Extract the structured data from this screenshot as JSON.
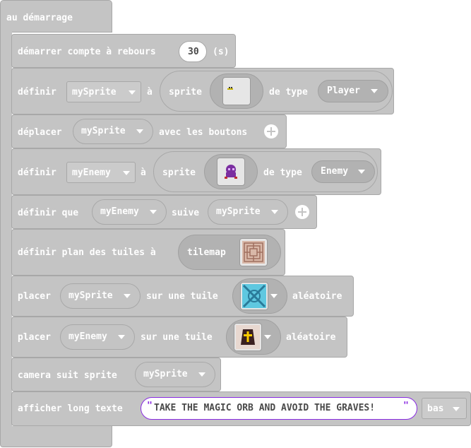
{
  "blocks": {
    "on_start": "au démarrage",
    "countdown": {
      "prefix": "démarrer compte à rebours",
      "value": "30",
      "suffix": "(s)"
    },
    "set_player": {
      "set": "définir",
      "var": "mySprite",
      "to": "à",
      "sprite": "sprite",
      "of_kind": "de type",
      "kind": "Player"
    },
    "move": {
      "prefix": "déplacer",
      "var": "mySprite",
      "suffix": "avec les boutons"
    },
    "set_enemy": {
      "set": "définir",
      "var": "myEnemy",
      "to": "à",
      "sprite": "sprite",
      "of_kind": "de type",
      "kind": "Enemy"
    },
    "follow": {
      "prefix": "définir que",
      "var": "myEnemy",
      "mid": "suive",
      "target": "mySprite"
    },
    "tilemap": {
      "prefix": "définir plan des tuiles à",
      "label": "tilemap"
    },
    "place_player": {
      "prefix": "placer",
      "var": "mySprite",
      "mid": "sur une tuile",
      "suffix": "aléatoire"
    },
    "place_enemy": {
      "prefix": "placer",
      "var": "myEnemy",
      "mid": "sur une tuile",
      "suffix": "aléatoire"
    },
    "camera": {
      "prefix": "camera suit sprite",
      "var": "mySprite"
    },
    "show_text": {
      "prefix": "afficher long texte",
      "text": "TAKE THE MAGIC ORB AND AVOID THE GRAVES!",
      "quote_open": "\"",
      "quote_close": "\"",
      "position": "bas"
    }
  },
  "colors": {
    "block": "#c4c4c4",
    "border": "#a8a8a8",
    "text": "#ffffff",
    "text_field": "#4a4a4a",
    "quote": "#8a2be2"
  }
}
